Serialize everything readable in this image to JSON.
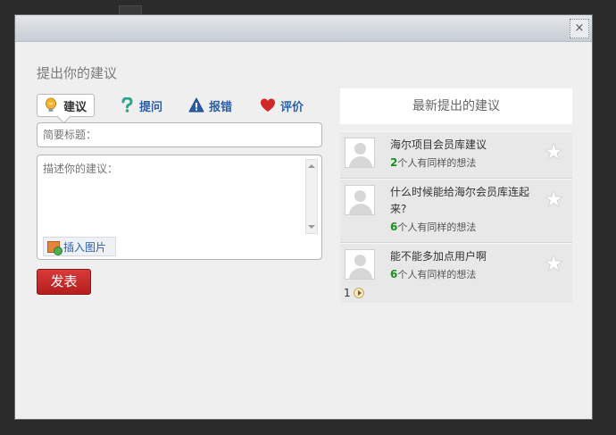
{
  "dialog": {
    "close_glyph": "×",
    "title": "提出你的建议"
  },
  "tabs": [
    {
      "label": "建议",
      "icon": "lightbulb-icon",
      "color": "#f0a020",
      "active": true
    },
    {
      "label": "提问",
      "icon": "question-icon",
      "color": "#2aa88a"
    },
    {
      "label": "报错",
      "icon": "warning-icon",
      "color": "#2a5fa8"
    },
    {
      "label": "评价",
      "icon": "heart-icon",
      "color": "#d02828"
    }
  ],
  "form": {
    "title_placeholder": "简要标题：",
    "desc_placeholder": "描述你的建议：",
    "insert_image_label": "插入图片",
    "submit_label": "发表"
  },
  "latest": {
    "header": "最新提出的建议",
    "items": [
      {
        "title": "海尔项目会员库建议",
        "count": "2",
        "count_suffix": "个人有同样的想法"
      },
      {
        "title": "什么时候能给海尔会员库连起来?",
        "count": "6",
        "count_suffix": "个人有同样的想法"
      },
      {
        "title": "能不能多加点用户啊",
        "count": "6",
        "count_suffix": "个人有同样的想法"
      }
    ],
    "page": "1"
  },
  "colors": {
    "accent_red": "#c02424",
    "link_blue": "#2a5fa8",
    "count_green": "#1d8f1d"
  }
}
